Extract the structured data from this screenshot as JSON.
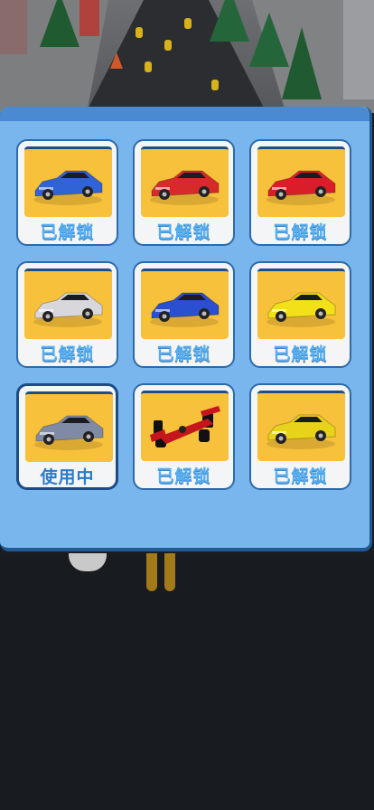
{
  "panel": {
    "cars": [
      {
        "name": "blue-muscle-car",
        "label": "已解锁",
        "body_color": "#2f63d6",
        "selected": false
      },
      {
        "name": "red-striped-car",
        "label": "已解锁",
        "body_color": "#d72a2a",
        "selected": false
      },
      {
        "name": "red-sports-car",
        "label": "已解锁",
        "body_color": "#d91e2a",
        "selected": false
      },
      {
        "name": "silver-supercar",
        "label": "已解锁",
        "body_color": "#d8d8dc",
        "selected": false
      },
      {
        "name": "blue-coupe",
        "label": "已解锁",
        "body_color": "#2a4fd0",
        "selected": false
      },
      {
        "name": "yellow-supercar",
        "label": "已解锁",
        "body_color": "#f2e019",
        "selected": false
      },
      {
        "name": "gray-classic-car",
        "label": "使用中",
        "body_color": "#7f8aa5",
        "selected": true
      },
      {
        "name": "red-f1-car",
        "label": "已解锁",
        "body_color": "#c4161c",
        "selected": false
      },
      {
        "name": "yellow-concept-car",
        "label": "已解锁",
        "body_color": "#e9d21a",
        "selected": false
      }
    ]
  },
  "colors": {
    "panel_bg": "#7ab6ee",
    "thumb_bg": "#f7c13b",
    "label_text": "#56aef0",
    "selected_border": "#1a4c86"
  }
}
